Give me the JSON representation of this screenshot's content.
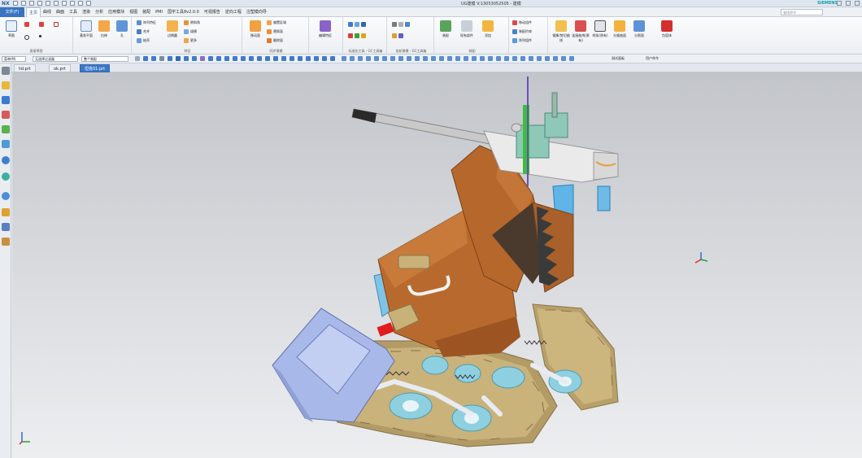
{
  "app": {
    "short_name": "NX",
    "window_title": "UG建模   V:13053052505 - 建模",
    "brand": "SIEMENS"
  },
  "quick_access": {
    "buttons": [
      "save-icon",
      "undo-icon",
      "redo-icon",
      "cut-icon",
      "copy-icon",
      "paste-icon",
      "repeat-icon",
      "touch-mode-icon",
      "switch-window-icon",
      "window-icon"
    ],
    "switch_window_label": "切换窗口",
    "window_label": "窗口"
  },
  "menu": {
    "file_tab": "文件(F)",
    "tabs": [
      "主页",
      "曲线",
      "曲面",
      "工具",
      "渲染",
      "分析",
      "应用模块",
      "视图",
      "装配",
      "PMI",
      "国宇工具8v2.0.0",
      "可视报告",
      "逆向工程",
      "注塑模向导"
    ],
    "active_tab": "主页",
    "search_placeholder": "查找命令"
  },
  "ribbon": {
    "groups": [
      {
        "label": "直接草图",
        "buttons": [
          "草图",
          "直线",
          "圆弧",
          "矩形",
          "圆",
          "点"
        ]
      },
      {
        "label": "",
        "buttons": [
          "基准平面",
          "拉伸",
          "孔"
        ]
      },
      {
        "label": "特征",
        "buttons": [
          "阵列特征",
          "合并",
          "抽壳",
          "边倒圆",
          "倒斜角",
          "拔模",
          "更多"
        ]
      },
      {
        "label": "同步建模",
        "buttons": [
          "偏置区域",
          "替换面",
          "删除面",
          "移动面",
          "更多"
        ]
      },
      {
        "label": "",
        "buttons": [
          "编辑特征"
        ]
      },
      {
        "label": "标准化工具 - GC工具箱",
        "buttons": []
      },
      {
        "label": "齿轮建模 - GC工具箱",
        "buttons": []
      },
      {
        "label": "弹簧工具 - GC工具箱",
        "buttons": []
      },
      {
        "label": "装配",
        "buttons": [
          "装配",
          "现有部件",
          "添加",
          "移动组件",
          "装配约束",
          "阵列组件"
        ]
      },
      {
        "label": "",
        "buttons": [
          "镜像/剪切曲线",
          "连接曲线(原有)",
          "样条(原有)",
          "光顺曲面",
          "分割面",
          "包容体"
        ]
      }
    ]
  },
  "toolbar": {
    "menu_label": "菜单(M)",
    "filter_value": "无选择过滤器",
    "scope_value": "整个装配",
    "snap_label": "",
    "view_label": "",
    "extras": [
      "测试面板",
      "用户命令"
    ]
  },
  "documents": {
    "tabs": [
      "lid.prt",
      "ok.prt",
      "坦克01.prt"
    ],
    "active": "坦克01.prt"
  },
  "resource_bar": {
    "icons": [
      "settings-icon",
      "assembly-navigator-icon",
      "constraint-navigator-icon",
      "part-navigator-icon",
      "reuse-library-icon",
      "hd3d-icon",
      "web-browser-icon",
      "history-icon",
      "process-studio-icon",
      "roles-icon",
      "system-materials-icon"
    ]
  },
  "colors": {
    "accent_blue": "#3a73c1",
    "hull_brown": "#b86a2e",
    "track_khaki": "#c8b07a",
    "motor_blue": "#a8b8e8",
    "wheel_cyan": "#8fd0e0",
    "barrel_gray": "#c9c9c9",
    "sight_green": "#3bbf3b"
  }
}
